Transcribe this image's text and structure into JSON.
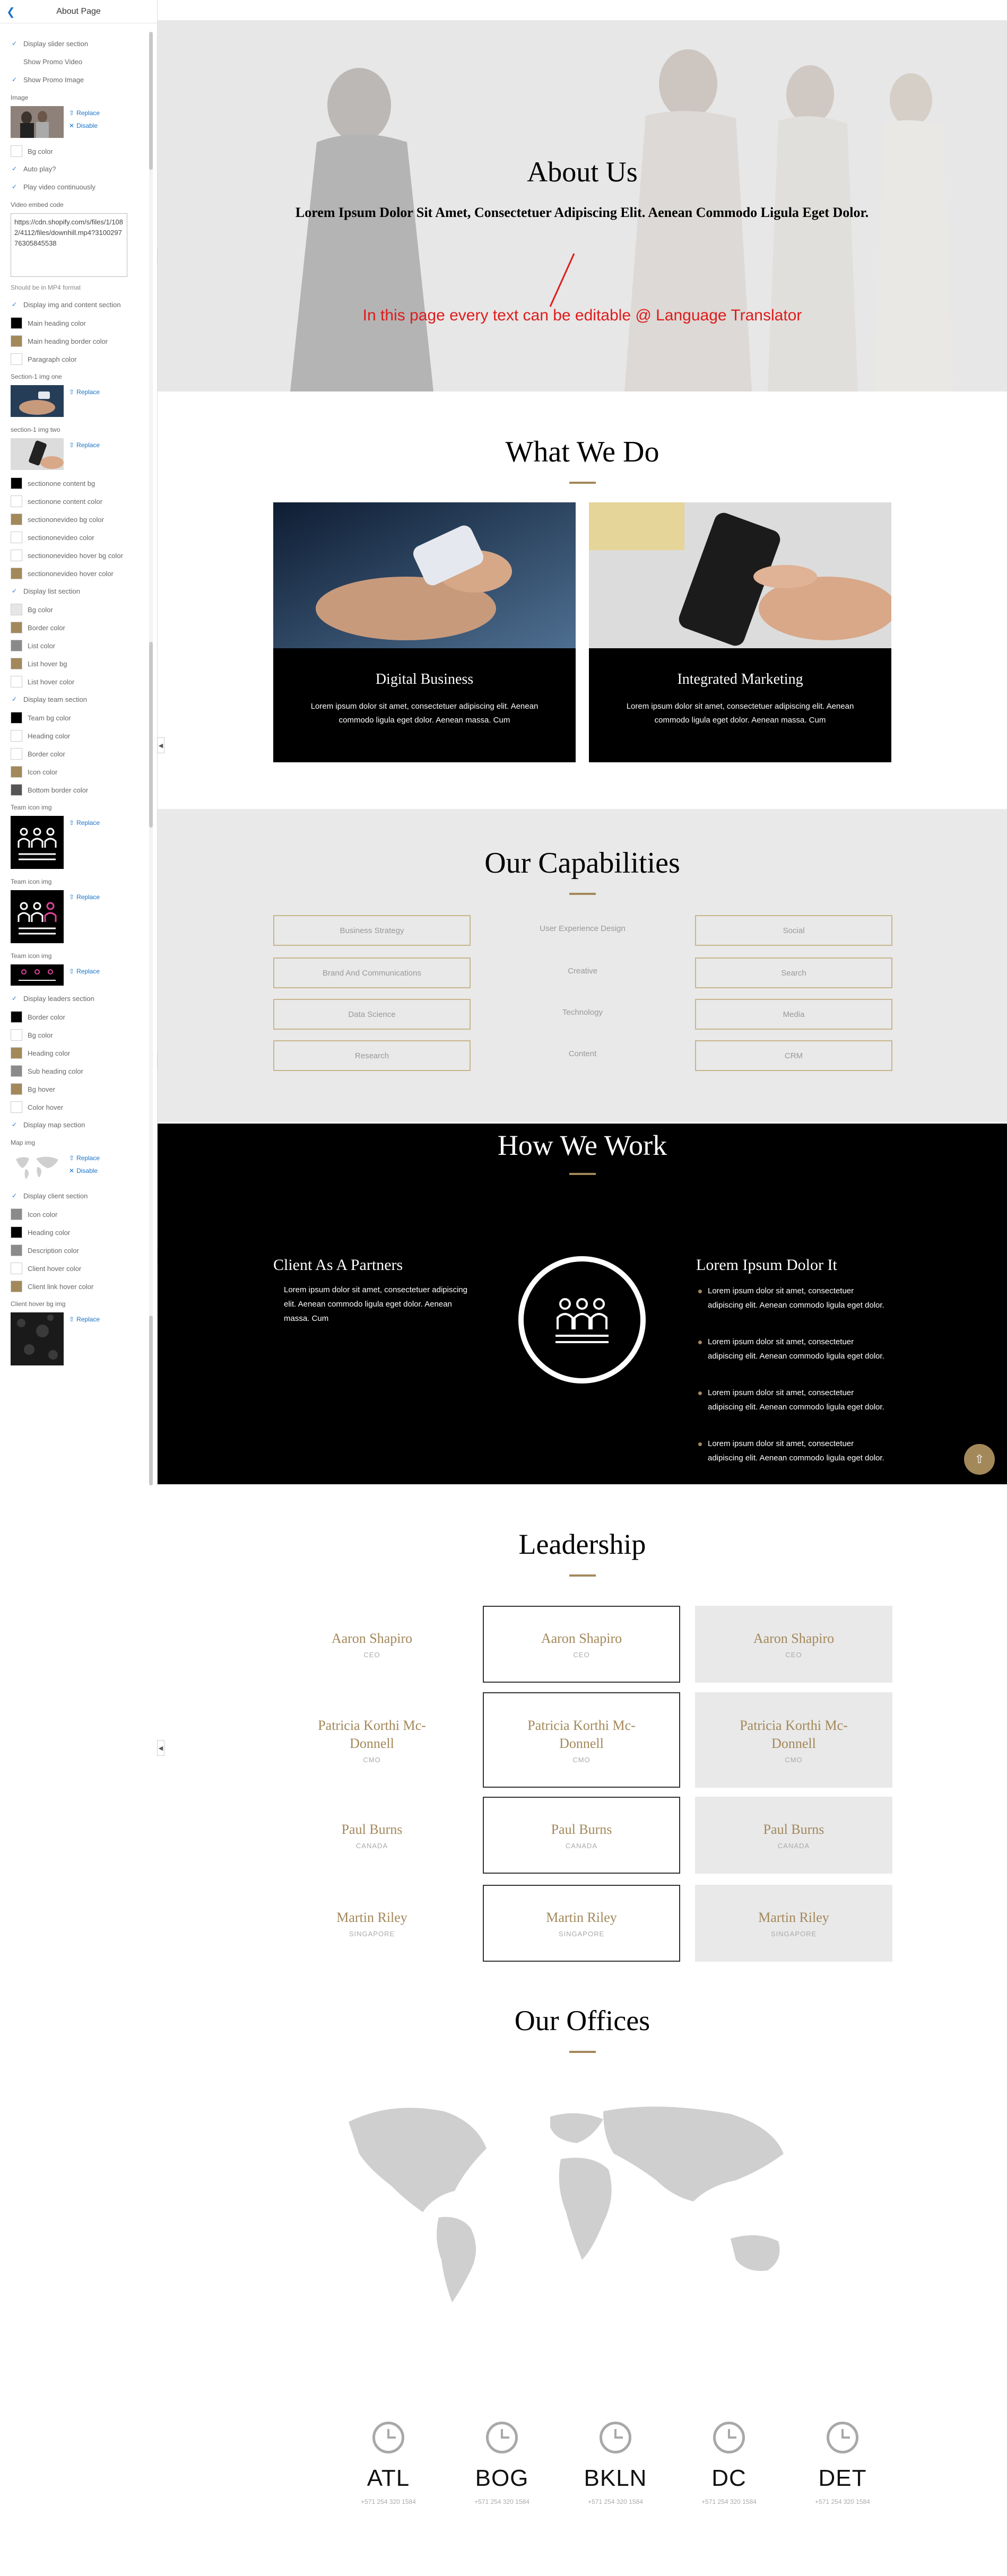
{
  "sidebar": {
    "title": "About Page",
    "items": [
      {
        "type": "check",
        "label": "Display slider section",
        "checked": true
      },
      {
        "type": "check",
        "label": "Show Promo Video",
        "checked": false
      },
      {
        "type": "check",
        "label": "Show Promo Image",
        "checked": true
      },
      {
        "type": "label",
        "label": "Image"
      },
      {
        "type": "image",
        "img": "people",
        "replace": "Replace",
        "disable": "Disable"
      },
      {
        "type": "swatch",
        "label": "Bg color",
        "color": "#ffffff"
      },
      {
        "type": "check",
        "label": "Auto play?",
        "checked": true
      },
      {
        "type": "check",
        "label": "Play video continuously",
        "checked": true
      },
      {
        "type": "label",
        "label": "Video embed code"
      },
      {
        "type": "textarea",
        "value": "https://cdn.shopify.com/s/files/1/1082/4112/files/downhill.mp4?310029776305845538"
      },
      {
        "type": "note",
        "label": "Should be in MP4 format"
      },
      {
        "type": "check",
        "label": "Display img and content section",
        "checked": true
      },
      {
        "type": "swatch",
        "label": "Main heading color",
        "color": "#000000"
      },
      {
        "type": "swatch",
        "label": "Main heading border color",
        "color": "#a3885a"
      },
      {
        "type": "swatch",
        "label": "Paragraph color",
        "color": "#ffffff"
      },
      {
        "type": "label",
        "label": "Section-1 img one"
      },
      {
        "type": "image",
        "img": "phone",
        "replace": "Replace"
      },
      {
        "type": "label",
        "label": "section-1 img two"
      },
      {
        "type": "image",
        "img": "hand",
        "replace": "Replace"
      },
      {
        "type": "swatch",
        "label": "sectionone content bg",
        "color": "#000000"
      },
      {
        "type": "swatch",
        "label": "sectionone content color",
        "color": "#ffffff"
      },
      {
        "type": "swatch",
        "label": "sectiononevideo bg color",
        "color": "#a3885a"
      },
      {
        "type": "swatch",
        "label": "sectiononevideo color",
        "color": "#ffffff"
      },
      {
        "type": "swatch",
        "label": "sectiononevideo hover bg color",
        "color": "#ffffff"
      },
      {
        "type": "swatch",
        "label": "sectiononevideo hover color",
        "color": "#a3885a"
      },
      {
        "type": "check",
        "label": "Display list section",
        "checked": true
      },
      {
        "type": "swatch",
        "label": "Bg color",
        "color": "#e6e6e6"
      },
      {
        "type": "swatch",
        "label": "Border color",
        "color": "#a3885a"
      },
      {
        "type": "swatch",
        "label": "List color",
        "color": "#8a8a8a"
      },
      {
        "type": "swatch",
        "label": "List hover bg",
        "color": "#a3885a"
      },
      {
        "type": "swatch",
        "label": "List hover color",
        "color": "#ffffff"
      },
      {
        "type": "check",
        "label": "Display team section",
        "checked": true
      },
      {
        "type": "swatch",
        "label": "Team bg color",
        "color": "#000000"
      },
      {
        "type": "swatch",
        "label": "Heading color",
        "color": "#ffffff"
      },
      {
        "type": "swatch",
        "label": "Border color",
        "color": "#ffffff"
      },
      {
        "type": "swatch",
        "label": "Icon color",
        "color": "#a3885a"
      },
      {
        "type": "swatch",
        "label": "Bottom border color",
        "color": "#555555"
      },
      {
        "type": "label",
        "label": "Team icon img"
      },
      {
        "type": "image",
        "img": "team1",
        "replace": "Replace"
      },
      {
        "type": "label",
        "label": "Team icon img"
      },
      {
        "type": "image",
        "img": "team2",
        "replace": "Replace"
      },
      {
        "type": "label",
        "label": "Team icon img"
      },
      {
        "type": "image",
        "img": "team3",
        "replace": "Replace"
      },
      {
        "type": "check",
        "label": "Display leaders section",
        "checked": true
      },
      {
        "type": "swatch",
        "label": "Border color",
        "color": "#000000"
      },
      {
        "type": "swatch",
        "label": "Bg color",
        "color": "#ffffff"
      },
      {
        "type": "swatch",
        "label": "Heading color",
        "color": "#a3885a"
      },
      {
        "type": "swatch",
        "label": "Sub heading color",
        "color": "#8a8a8a"
      },
      {
        "type": "swatch",
        "label": "Bg hover",
        "color": "#a3885a"
      },
      {
        "type": "swatch",
        "label": "Color hover",
        "color": "#ffffff"
      },
      {
        "type": "check",
        "label": "Display map section",
        "checked": true
      },
      {
        "type": "label",
        "label": "Map img"
      },
      {
        "type": "image",
        "img": "map",
        "replace": "Replace",
        "disable": "Disable"
      },
      {
        "type": "check",
        "label": "Display client section",
        "checked": true
      },
      {
        "type": "swatch",
        "label": "Icon color",
        "color": "#8a8a8a"
      },
      {
        "type": "swatch",
        "label": "Heading color",
        "color": "#000000"
      },
      {
        "type": "swatch",
        "label": "Description color",
        "color": "#8a8a8a"
      },
      {
        "type": "swatch",
        "label": "Client hover color",
        "color": "#ffffff"
      },
      {
        "type": "swatch",
        "label": "Client link hover color",
        "color": "#a3885a"
      },
      {
        "type": "label",
        "label": "Client hover bg img"
      },
      {
        "type": "image",
        "img": "texture",
        "replace": "Replace"
      }
    ]
  },
  "hero": {
    "title": "About Us",
    "subtitle": "Lorem Ipsum Dolor Sit Amet, Consectetuer Adipiscing Elit. Aenean Commodo Ligula Eget Dolor.",
    "annotation": "In this page every text can be editable @ Language Translator"
  },
  "what_we_do": {
    "title": "What We Do",
    "cards": [
      {
        "title": "Digital Business",
        "text": "Lorem ipsum dolor sit amet, consectetuer adipiscing elit. Aenean commodo ligula eget dolor. Aenean massa. Cum"
      },
      {
        "title": "Integrated Marketing",
        "text": "Lorem ipsum dolor sit amet, consectetuer adipiscing elit. Aenean commodo ligula eget dolor. Aenean massa. Cum"
      }
    ]
  },
  "capabilities": {
    "title": "Our Capabilities",
    "left": [
      "Business Strategy",
      "Brand And Communications",
      "Data Science",
      "Research"
    ],
    "middle": [
      "User Experience Design",
      "Creative",
      "Technology",
      "Content"
    ],
    "right": [
      "Social",
      "Search",
      "Media",
      "CRM"
    ]
  },
  "how_we_work": {
    "title": "How We Work",
    "left_title": "Client As A Partners",
    "left_text": "Lorem ipsum dolor sit amet, consectetuer adipiscing elit. Aenean commodo ligula eget dolor. Aenean massa. Cum",
    "right_title": "Lorem Ipsum Dolor It",
    "bullets": [
      "Lorem ipsum dolor sit amet, consectetuer adipiscing elit. Aenean commodo ligula eget dolor.",
      "Lorem ipsum dolor sit amet, consectetuer adipiscing elit. Aenean commodo ligula eget dolor.",
      "Lorem ipsum dolor sit amet, consectetuer adipiscing elit. Aenean commodo ligula eget dolor.",
      "Lorem ipsum dolor sit amet, consectetuer adipiscing elit. Aenean commodo ligula eget dolor."
    ]
  },
  "leadership": {
    "title": "Leadership",
    "rows": [
      {
        "name": "Aaron Shapiro",
        "role": "CEO"
      },
      {
        "name": "Patricia Korthi Mc-Donnell",
        "role": "CMO"
      },
      {
        "name": "Paul Burns",
        "role": "CANADA"
      },
      {
        "name": "Martin Riley",
        "role": "SINGAPORE"
      }
    ]
  },
  "offices": {
    "title": "Our Offices",
    "list": [
      {
        "code": "ATL",
        "phone": "+571 254 320 1584"
      },
      {
        "code": "BOG",
        "phone": "+571 254 320 1584"
      },
      {
        "code": "BKLN",
        "phone": "+571 254 320 1584"
      },
      {
        "code": "DC",
        "phone": "+571 254 320 1584"
      },
      {
        "code": "DET",
        "phone": "+571 254 320 1584"
      }
    ]
  },
  "colors": {
    "accent": "#a3885a",
    "link": "#1a73c8",
    "annotation": "#e01b1b"
  }
}
